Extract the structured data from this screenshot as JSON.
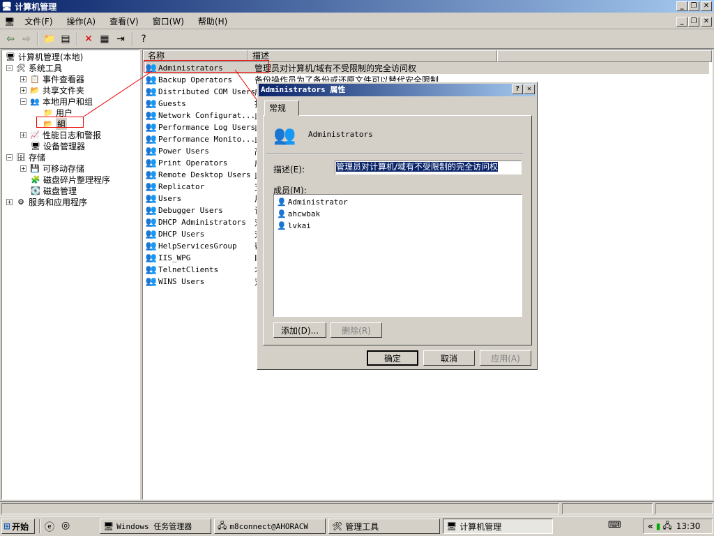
{
  "window": {
    "title": "计算机管理",
    "icon": "computer-icon"
  },
  "menu": [
    "文件(F)",
    "操作(A)",
    "查看(V)",
    "窗口(W)",
    "帮助(H)"
  ],
  "tree": {
    "root": "计算机管理(本地)",
    "system_tools": "系统工具",
    "event_viewer": "事件查看器",
    "shared_folders": "共享文件夹",
    "local_users": "本地用户和组",
    "users": "用户",
    "groups": "組",
    "perf_logs": "性能日志和警报",
    "device_manager": "设备管理器",
    "storage": "存储",
    "removable": "可移动存储",
    "defrag": "磁盘碎片整理程序",
    "disk_mgmt": "磁盘管理",
    "services": "服务和应用程序"
  },
  "list": {
    "col_name": "名称",
    "col_desc": "描述",
    "rows": [
      {
        "name": "Administrators",
        "desc": "管理员对计算机/域有不受限制的完全访问权"
      },
      {
        "name": "Backup Operators",
        "desc": "备份操作员为了备份或还原文件可以替代安全限制"
      },
      {
        "name": "Distributed COM Users",
        "desc": "成"
      },
      {
        "name": "Guests",
        "desc": "按"
      },
      {
        "name": "Network Configurat...",
        "desc": "此"
      },
      {
        "name": "Performance Log Users",
        "desc": "此"
      },
      {
        "name": "Performance Monito...",
        "desc": "此"
      },
      {
        "name": "Power Users",
        "desc": "高"
      },
      {
        "name": "Print Operators",
        "desc": "成"
      },
      {
        "name": "Remote Desktop Users",
        "desc": "此"
      },
      {
        "name": "Replicator",
        "desc": "支"
      },
      {
        "name": "Users",
        "desc": "用"
      },
      {
        "name": "Debugger Users",
        "desc": "调"
      },
      {
        "name": "DHCP Administrators",
        "desc": "对"
      },
      {
        "name": "DHCP Users",
        "desc": "对"
      },
      {
        "name": "HelpServicesGroup",
        "desc": "帮"
      },
      {
        "name": "IIS_WPG",
        "desc": "I"
      },
      {
        "name": "TelnetClients",
        "desc": "本"
      },
      {
        "name": "WINS Users",
        "desc": "对"
      }
    ]
  },
  "dialog": {
    "title": "Administrators 属性",
    "help_btn": "?",
    "close_btn": "✕",
    "tab": "常规",
    "group_name": "Administrators",
    "desc_label": "描述(E):",
    "desc_value": "管理员对计算机/域有不受限制的完全访问权",
    "members_label": "成员(M):",
    "members": [
      "Administrator",
      "ahcwbak",
      "lvkai"
    ],
    "add_btn": "添加(D)...",
    "remove_btn": "删除(R)",
    "ok_btn": "确定",
    "cancel_btn": "取消",
    "apply_btn": "应用(A)"
  },
  "taskbar": {
    "start": "开始",
    "tasks": [
      "Windows 任务管理器",
      "m8connect@AHORACW",
      "管理工具",
      "计算机管理"
    ],
    "clock": "13:30",
    "tray_chevron": "«"
  }
}
